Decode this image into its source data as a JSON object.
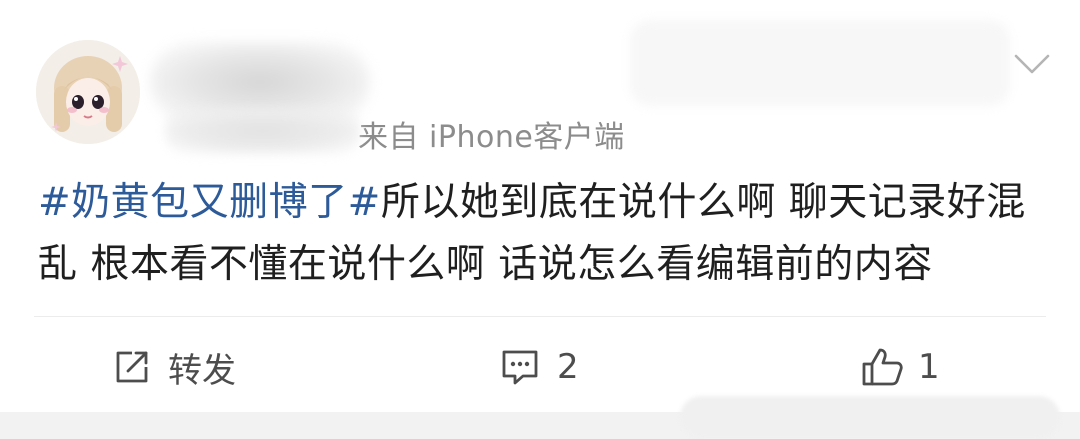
{
  "post": {
    "meta_source": "来自 iPhone客户端",
    "topic": "#奶黄包又删博了#",
    "body": "所以她到底在说什么啊 聊天记录好混乱 根本看不懂在说什么啊 话说怎么看编辑前的内容"
  },
  "actions": {
    "repost_label": "转发",
    "comment_count": "2",
    "like_count": "1"
  },
  "icons": {
    "menu": "chevron-down-icon",
    "repost": "repost-icon",
    "comment": "comment-icon",
    "like": "thumbs-up-icon"
  },
  "colors": {
    "topic": "#2d5a99",
    "text": "#1f1f1f",
    "meta": "#8c8c8c",
    "action": "#4d4d4d"
  }
}
